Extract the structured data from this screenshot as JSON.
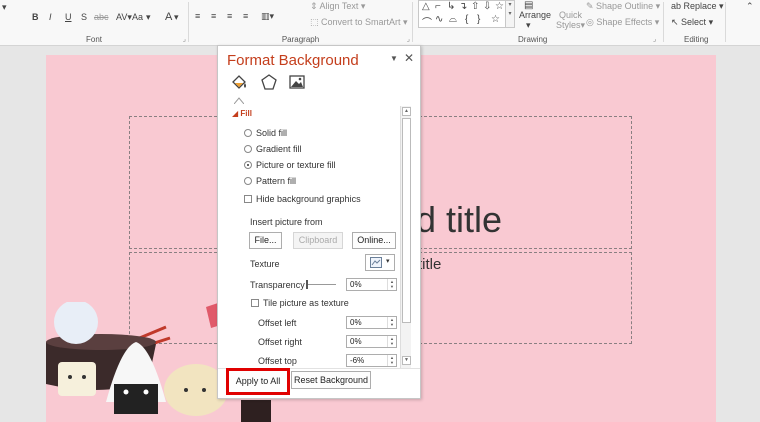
{
  "ribbon": {
    "font_group": {
      "label": "Font",
      "bold": "B",
      "italic": "I",
      "underline": "U",
      "strike": "S",
      "char_spacing": "abc",
      "change_case": "Aa",
      "font_color": "A"
    },
    "paragraph_group": {
      "label": "Paragraph",
      "align_text": "Align Text",
      "convert_smartart": "Convert to SmartArt"
    },
    "drawing_group": {
      "label": "Drawing",
      "arrange": "Arrange",
      "quick_styles_1": "Quick",
      "quick_styles_2": "Styles",
      "shape_outline": "Shape Outline",
      "shape_effects": "Shape Effects"
    },
    "editing_group": {
      "label": "Editing",
      "replace": "Replace",
      "select": "Select"
    }
  },
  "slide": {
    "title_visible": "d title",
    "subtitle_visible": "title"
  },
  "pane": {
    "title": "Format Background",
    "section_fill": "Fill",
    "options": {
      "solid": "Solid fill",
      "gradient": "Gradient fill",
      "picture": "Picture or texture fill",
      "pattern": "Pattern fill"
    },
    "selected_option": "picture",
    "hide_background": "Hide background graphics",
    "insert_from": "Insert picture from",
    "file_btn": "File...",
    "clipboard_btn": "Clipboard",
    "online_btn": "Online...",
    "texture_label": "Texture",
    "transparency_label": "Transparency",
    "transparency_value": "0%",
    "tile_label": "Tile picture as texture",
    "offset_left_label": "Offset left",
    "offset_left_value": "0%",
    "offset_right_label": "Offset right",
    "offset_right_value": "0%",
    "offset_top_label": "Offset top",
    "offset_top_value": "-6%"
  },
  "footer": {
    "apply_all": "Apply to All",
    "reset_background": "Reset Background"
  },
  "colors": {
    "accent": "#c43e1c",
    "slide_bg": "#f9c9d2",
    "highlight": "#e00000"
  }
}
